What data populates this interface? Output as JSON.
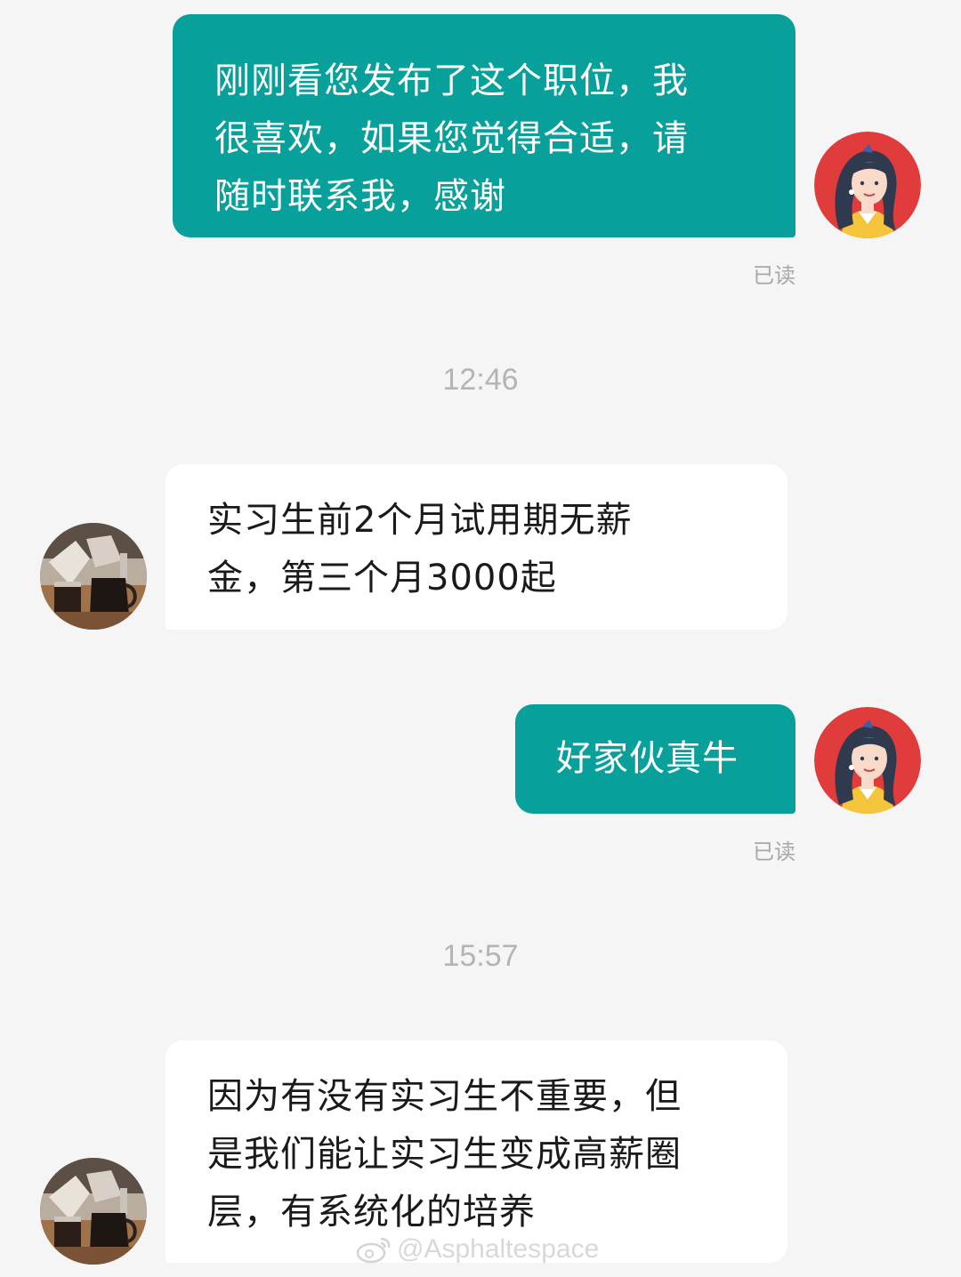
{
  "messages": [
    {
      "from": "me",
      "lines": [
        "刚刚看您发布了这个职位，我",
        "很喜欢，如果您觉得合适，请",
        "随时联系我，感谢"
      ],
      "status": "已读"
    },
    {
      "type": "time",
      "label": "12:46"
    },
    {
      "from": "them",
      "lines": [
        "实习生前2个月试用期无薪",
        "金，第三个月3000起"
      ]
    },
    {
      "from": "me",
      "lines": [
        "好家伙真牛"
      ],
      "status": "已读"
    },
    {
      "type": "time",
      "label": "15:57"
    },
    {
      "from": "them",
      "lines": [
        "因为有没有实习生不重要，但",
        "是我们能让实习生变成高薪圈",
        "层，有系统化的培养"
      ]
    }
  ],
  "avatars": {
    "me": "woman-avatar-icon",
    "them": "coffee-photo-avatar"
  },
  "watermark": {
    "icon": "weibo-icon",
    "text": "@Asphaltespace"
  },
  "colors": {
    "outgoing_bubble": "#08a09a",
    "incoming_bubble": "#ffffff",
    "background": "#f5f5f5",
    "read_status": "#a8a8a8",
    "time_label": "#b4b4b4"
  }
}
